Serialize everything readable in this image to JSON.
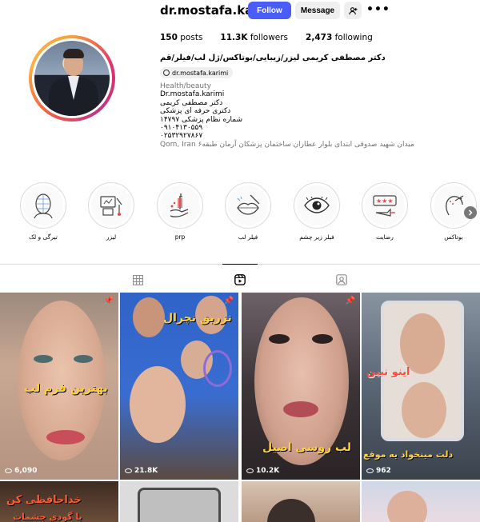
{
  "header": {
    "username": "dr.mostafa.karimi",
    "follow_label": "Follow",
    "message_label": "Message",
    "add_user_label": "+A",
    "more_label": "•••",
    "posts_count": "150",
    "posts_label": "posts",
    "followers_count": "11.3K",
    "followers_label": "followers",
    "following_count": "2,473",
    "following_label": "following",
    "full_name": "دکتر مصطفی کریمی لیزر/زیبایی/بوتاکس/ژل لب/فیلر/قم",
    "threads_handle": "dr.mostafa.karimi",
    "bio": {
      "category": "Health/beauty",
      "lines": [
        "Dr.mostafa.karimi",
        "دکتر مصطفی کریمی",
        "دکتری حرفه ای پزشکی",
        "شماره نظام پزشکی ۱۴۷۹۷",
        "۰۹۱۰۴۱۳۰۵۵۹",
        "۰۲۵۳۲۹۲۷۸۶۷"
      ],
      "location": "Qom, Iran  میدان شهید صدوقی ابتدای بلوار عطاران ساختمان پزشکان آرمان طبقه۶"
    }
  },
  "highlights": [
    {
      "label": "تیرگی و لک",
      "icon": "face-grid-icon"
    },
    {
      "label": "لیزر",
      "icon": "laser-device-icon"
    },
    {
      "label": "prp",
      "icon": "syringe-hand-icon"
    },
    {
      "label": "فیلر لب",
      "icon": "lips-filler-icon"
    },
    {
      "label": "فیلر زیر چشم",
      "icon": "eye-icon"
    },
    {
      "label": "رضایت",
      "icon": "rating-stars-icon"
    },
    {
      "label": "بوتاکس",
      "icon": "botox-face-icon"
    }
  ],
  "tabs": [
    {
      "name": "posts",
      "icon": "grid-icon"
    },
    {
      "name": "reels",
      "icon": "reels-icon"
    },
    {
      "name": "tagged",
      "icon": "tagged-icon"
    }
  ],
  "grid": [
    {
      "caption": "بهترین فرم لب",
      "views": "6,090",
      "pinned": true,
      "bg": "#b89b86"
    },
    {
      "caption": "تزریق نچرال",
      "views": "21.8K",
      "pinned": true,
      "bg": "#3466c7"
    },
    {
      "caption": "لب روسی اصیل",
      "views": "10.2K",
      "pinned": true,
      "bg": "#4a4548"
    },
    {
      "caption": "اینو نبین",
      "caption2": "دلت مینخواد یه موقع",
      "views": "962",
      "pinned": false,
      "bg": "#5d6a78"
    },
    {
      "caption": "خداحافظی کن",
      "caption2": "با گودی چشمات",
      "views": "",
      "pinned": false,
      "bg": "#6b4d3a"
    },
    {
      "caption": "",
      "views": "",
      "pinned": false,
      "bg": "#d9d9d9"
    },
    {
      "caption": "",
      "views": "",
      "pinned": false,
      "bg": "#c9b7a6"
    },
    {
      "caption": "",
      "views": "",
      "pinned": false,
      "bg": "#cfd7e6"
    }
  ]
}
